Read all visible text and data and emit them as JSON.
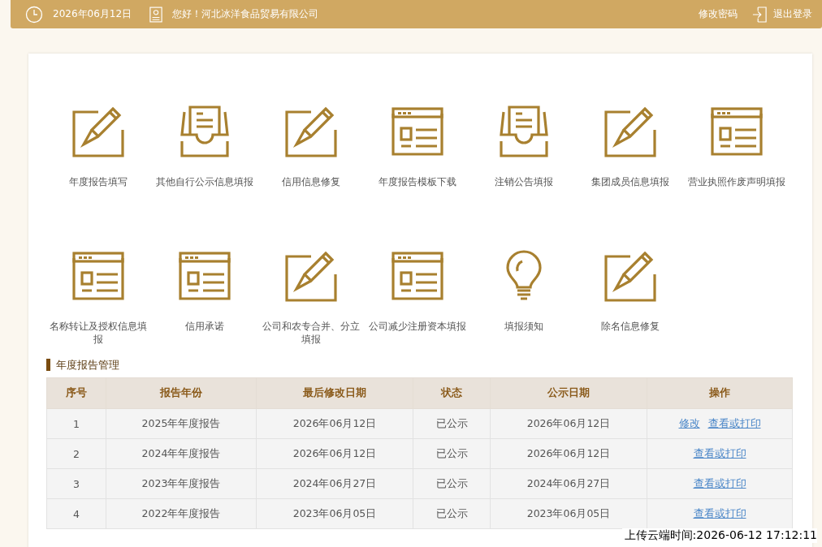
{
  "top_bar": {
    "date": "2026年06月12日",
    "greeting": "您好！河北冰洋食品贸易有限公司",
    "change_password": "修改密码",
    "logout": "退出登录"
  },
  "tiles": [
    {
      "label": "年度报告填写",
      "kind": "pencil"
    },
    {
      "label": "其他自行公示信息填报",
      "kind": "tray"
    },
    {
      "label": "信用信息修复",
      "kind": "pencil"
    },
    {
      "label": "年度报告模板下载",
      "kind": "window"
    },
    {
      "label": "注销公告填报",
      "kind": "tray"
    },
    {
      "label": "集团成员信息填报",
      "kind": "pencil"
    },
    {
      "label": "营业执照作废声明填报",
      "kind": "window"
    },
    {
      "label": "名称转让及授权信息填报",
      "kind": "window"
    },
    {
      "label": "信用承诺",
      "kind": "window"
    },
    {
      "label": "公司和农专合并、分立填报",
      "kind": "pencil"
    },
    {
      "label": "公司减少注册资本填报",
      "kind": "window"
    },
    {
      "label": "填报须知",
      "kind": "bulb"
    },
    {
      "label": "除名信息修复",
      "kind": "pencil"
    }
  ],
  "section_title": "年度报告管理",
  "table": {
    "columns": [
      "序号",
      "报告年份",
      "最后修改日期",
      "状态",
      "公示日期",
      "操作"
    ],
    "rows": [
      {
        "no": "1",
        "year": "2025年年度报告",
        "modified": "2026年06月12日",
        "status": "已公示",
        "published": "2026年06月12日",
        "actions": [
          "修改",
          "查看或打印"
        ]
      },
      {
        "no": "2",
        "year": "2024年年度报告",
        "modified": "2026年06月12日",
        "status": "已公示",
        "published": "2026年06月12日",
        "actions": [
          "查看或打印"
        ]
      },
      {
        "no": "3",
        "year": "2023年年度报告",
        "modified": "2024年06月27日",
        "status": "已公示",
        "published": "2024年06月27日",
        "actions": [
          "查看或打印"
        ]
      },
      {
        "no": "4",
        "year": "2022年年度报告",
        "modified": "2023年06月05日",
        "status": "已公示",
        "published": "2023年06月05日",
        "actions": [
          "查看或打印"
        ]
      }
    ]
  },
  "upload_stamp": "上传云端时间:2026-06-12 17:12:11"
}
